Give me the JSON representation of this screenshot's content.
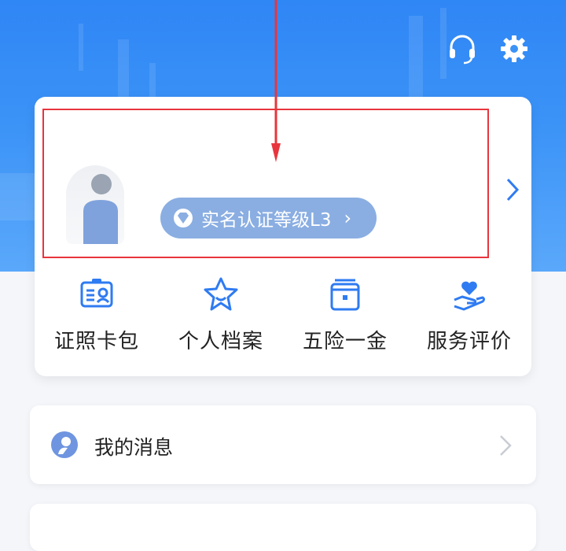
{
  "header": {
    "icons": [
      "headset-icon",
      "gear-icon"
    ],
    "colors": {
      "hero": "#3b93f7",
      "accent": "#2f7bf2",
      "highlight": "#e8353d"
    }
  },
  "profile": {
    "verification_label": "实名认证等级L3"
  },
  "services": [
    {
      "label": "证照卡包",
      "icon": "id-card-icon"
    },
    {
      "label": "个人档案",
      "icon": "star-profile-icon"
    },
    {
      "label": "五险一金",
      "icon": "wallet-icon"
    },
    {
      "label": "服务评价",
      "icon": "heart-hand-icon"
    }
  ],
  "menu": {
    "messages_label": "我的消息"
  }
}
